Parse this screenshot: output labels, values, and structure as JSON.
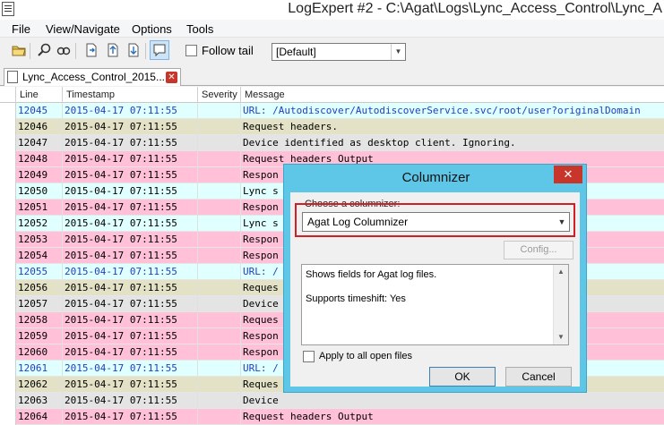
{
  "window": {
    "title": "LogExpert #2 - C:\\Agat\\Logs\\Lync_Access_Control\\Lync_A"
  },
  "menu": {
    "items": [
      "File",
      "View/Navigate",
      "Options",
      "Tools"
    ]
  },
  "toolbar": {
    "follow_tail_label": "Follow tail",
    "follow_tail_checked": false,
    "columnizer_value": "[Default]"
  },
  "tab": {
    "label": "Lync_Access_Control_2015..."
  },
  "grid": {
    "columns": [
      "Line",
      "Timestamp",
      "Severity",
      "Message"
    ],
    "rows": [
      {
        "line": "12045",
        "ts": "2015-04-17 07:11:55",
        "sev": "",
        "msg": "URL: /Autodiscover/AutodiscoverService.svc/root/user?originalDomain",
        "bg": "#e0ffff",
        "fg": "#1f3fc4"
      },
      {
        "line": "12046",
        "ts": "2015-04-17 07:11:55",
        "sev": "",
        "msg": "Request headers.",
        "bg": "#e4e2c6",
        "fg": "#000000"
      },
      {
        "line": "12047",
        "ts": "2015-04-17 07:11:55",
        "sev": "",
        "msg": "Device identified as desktop client. Ignoring.",
        "bg": "#e4e4e4",
        "fg": "#000000"
      },
      {
        "line": "12048",
        "ts": "2015-04-17 07:11:55",
        "sev": "",
        "msg": "Request headers Output",
        "bg": "#ffc0d8",
        "fg": "#000000"
      },
      {
        "line": "12049",
        "ts": "2015-04-17 07:11:55",
        "sev": "",
        "msg": "Respon",
        "bg": "#ffc0d8",
        "fg": "#000000"
      },
      {
        "line": "12050",
        "ts": "2015-04-17 07:11:55",
        "sev": "",
        "msg": "Lync s",
        "bg": "#e0ffff",
        "fg": "#000000"
      },
      {
        "line": "12051",
        "ts": "2015-04-17 07:11:55",
        "sev": "",
        "msg": "Respon",
        "bg": "#ffc0d8",
        "fg": "#000000"
      },
      {
        "line": "12052",
        "ts": "2015-04-17 07:11:55",
        "sev": "",
        "msg": "Lync s",
        "bg": "#e0ffff",
        "fg": "#000000"
      },
      {
        "line": "12053",
        "ts": "2015-04-17 07:11:55",
        "sev": "",
        "msg": "Respon",
        "bg": "#ffc0d8",
        "fg": "#000000"
      },
      {
        "line": "12054",
        "ts": "2015-04-17 07:11:55",
        "sev": "",
        "msg": "Respon",
        "bg": "#ffc0d8",
        "fg": "#000000"
      },
      {
        "line": "12055",
        "ts": "2015-04-17 07:11:55",
        "sev": "",
        "msg": "URL: /",
        "bg": "#e0ffff",
        "fg": "#1f3fc4"
      },
      {
        "line": "12056",
        "ts": "2015-04-17 07:11:55",
        "sev": "",
        "msg": "Reques",
        "bg": "#e4e2c6",
        "fg": "#000000"
      },
      {
        "line": "12057",
        "ts": "2015-04-17 07:11:55",
        "sev": "",
        "msg": "Device",
        "bg": "#e4e4e4",
        "fg": "#000000"
      },
      {
        "line": "12058",
        "ts": "2015-04-17 07:11:55",
        "sev": "",
        "msg": "Reques",
        "bg": "#ffc0d8",
        "fg": "#000000"
      },
      {
        "line": "12059",
        "ts": "2015-04-17 07:11:55",
        "sev": "",
        "msg": "Respon",
        "bg": "#ffc0d8",
        "fg": "#000000"
      },
      {
        "line": "12060",
        "ts": "2015-04-17 07:11:55",
        "sev": "",
        "msg": "Respon",
        "bg": "#ffc0d8",
        "fg": "#000000"
      },
      {
        "line": "12061",
        "ts": "2015-04-17 07:11:55",
        "sev": "",
        "msg": "URL: /",
        "bg": "#e0ffff",
        "fg": "#1f3fc4"
      },
      {
        "line": "12062",
        "ts": "2015-04-17 07:11:55",
        "sev": "",
        "msg": "Reques",
        "bg": "#e4e2c6",
        "fg": "#000000"
      },
      {
        "line": "12063",
        "ts": "2015-04-17 07:11:55",
        "sev": "",
        "msg": "Device",
        "bg": "#e4e4e4",
        "fg": "#000000"
      },
      {
        "line": "12064",
        "ts": "2015-04-17 07:11:55",
        "sev": "",
        "msg": "Request headers Output",
        "bg": "#ffc0d8",
        "fg": "#000000"
      }
    ]
  },
  "dialog": {
    "title": "Columnizer",
    "close_label": "✕",
    "choose_label": "Choose a columnizer:",
    "selected": "Agat Log Columnizer",
    "config_label": "Config...",
    "desc_line1": "Shows fields for Agat log files.",
    "desc_line2": "Supports timeshift: Yes",
    "apply_label": "Apply to all open files",
    "apply_checked": false,
    "ok_label": "OK",
    "cancel_label": "Cancel"
  },
  "colors": {
    "dialog_frame": "#5ec7e8",
    "highlight": "#d21f26",
    "close": "#c7352b"
  }
}
